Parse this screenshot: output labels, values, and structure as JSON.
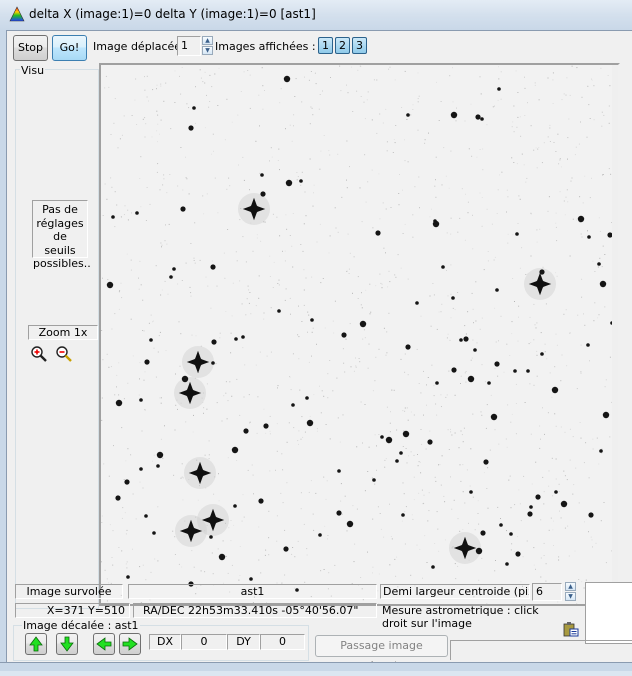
{
  "window": {
    "title": "delta X (image:1)=0  delta Y (image:1)=0 [ast1]",
    "app_icon": "rainbow-triangle-icon"
  },
  "toolbar": {
    "stop_label": "Stop",
    "go_label": "Go!",
    "moved_image_label": "Image déplacée :",
    "moved_image_value": "1",
    "displayed_images_label": "Images affichées :",
    "image_buttons": [
      "1",
      "2",
      "3"
    ]
  },
  "visu_panel": {
    "title": "Visu",
    "no_thresholds_text": "Pas de\nréglages de\nseuils\npossibles..",
    "zoom_label": "Zoom 1x",
    "zoom_in_icon": "zoom-in-icon",
    "zoom_out_icon": "zoom-out-icon"
  },
  "status": {
    "hovered_image_label": "Image survolée",
    "hovered_image_value": "ast1",
    "coords": "X=371 Y=510",
    "radec": "RA/DEC 22h53m33.410s -05°40'56.07\"",
    "centroid_label": "Demi largeur centroide (pixels)",
    "centroid_value": "6",
    "astrometry_hint": "Mesure astrometrique : click droit sur l'image"
  },
  "offset_panel": {
    "title": "Image décalée : ast1",
    "up_icon": "arrow-up-icon",
    "down_icon": "arrow-down-icon",
    "left_icon": "arrow-left-icon",
    "right_icon": "arrow-right-icon",
    "dx_label": "DX",
    "dx_value": "0",
    "dy_label": "DY",
    "dy_value": "0",
    "next_image_label": "Passage image suivante",
    "clipboard_icon": "clipboard-icon"
  },
  "colors": {
    "accent_blue": "#a7d9f5",
    "arrow_green": "#22e022",
    "sky_background": "#f2f2f2",
    "star_color": "#101010"
  }
}
